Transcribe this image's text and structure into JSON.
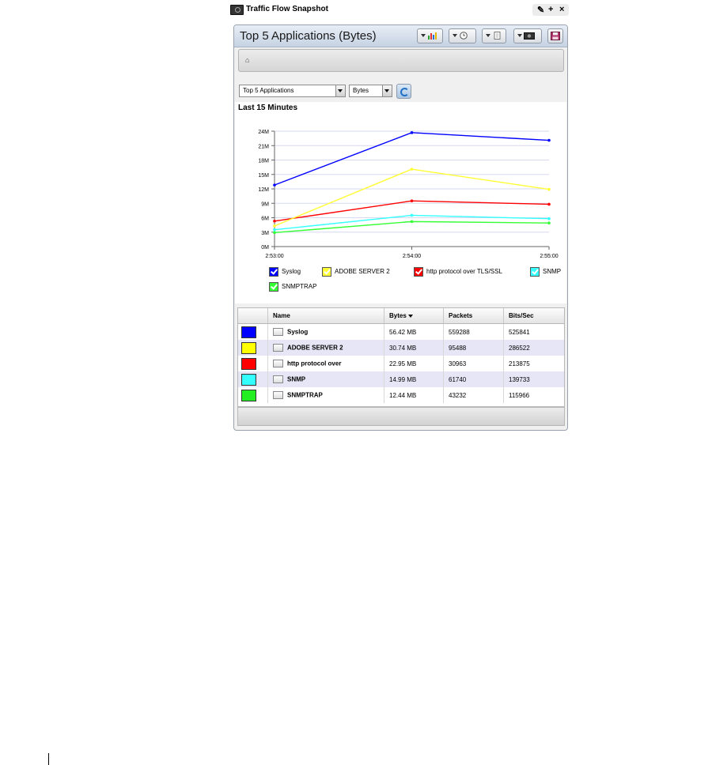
{
  "window": {
    "title": "Traffic Flow Snapshot",
    "controls": [
      "settings-icon",
      "add-icon",
      "close-icon"
    ]
  },
  "panel": {
    "title": "Top 5 Applications (Bytes)",
    "toolbar": [
      "chart-type-icon",
      "time-range-icon",
      "export-icon",
      "snapshot-icon",
      "save-icon"
    ],
    "breadcrumb_icon": "home-icon"
  },
  "filters": {
    "report": "Top 5 Applications",
    "metric": "Bytes",
    "refresh_icon": "refresh-icon"
  },
  "chart_data": {
    "type": "line",
    "title": "Last 15 Minutes",
    "x": [
      "2:53:00",
      "2:54:00",
      "2:55:00"
    ],
    "yticks": [
      "0M",
      "3M",
      "6M",
      "9M",
      "12M",
      "15M",
      "18M",
      "21M",
      "24M"
    ],
    "ylim": [
      0,
      24
    ],
    "grid": true,
    "legend_placement": "bottom",
    "series": [
      {
        "name": "Syslog",
        "color": "#0000ff",
        "values": [
          12.8,
          23.7,
          22.1
        ]
      },
      {
        "name": "ADOBE SERVER 2",
        "color": "#ffff33",
        "values": [
          4.3,
          16.1,
          11.9
        ]
      },
      {
        "name": "http protocol over TLS/SSL",
        "color": "#ff0000",
        "values": [
          5.3,
          9.5,
          8.8
        ]
      },
      {
        "name": "SNMP",
        "color": "#33ffff",
        "values": [
          3.5,
          6.5,
          5.8
        ]
      },
      {
        "name": "SNMPTRAP",
        "color": "#33ff33",
        "values": [
          2.9,
          5.2,
          4.9
        ]
      }
    ]
  },
  "table": {
    "headers": [
      "",
      "Name",
      "Bytes",
      "Packets",
      "Bits/Sec"
    ],
    "sort_column": "Bytes",
    "rows": [
      {
        "color": "#0000ff",
        "name": "Syslog",
        "bytes": "56.42 MB",
        "packets": "559288",
        "bits": "525841"
      },
      {
        "color": "#ffff00",
        "name": "ADOBE SERVER 2",
        "bytes": "30.74 MB",
        "packets": "95488",
        "bits": "286522"
      },
      {
        "color": "#ff0000",
        "name": "http protocol over",
        "bytes": "22.95 MB",
        "packets": "30963",
        "bits": "213875"
      },
      {
        "color": "#33ffff",
        "name": "SNMP",
        "bytes": "14.99 MB",
        "packets": "61740",
        "bits": "139733"
      },
      {
        "color": "#22ee22",
        "name": "SNMPTRAP",
        "bytes": "12.44 MB",
        "packets": "43232",
        "bits": "115966"
      }
    ]
  }
}
